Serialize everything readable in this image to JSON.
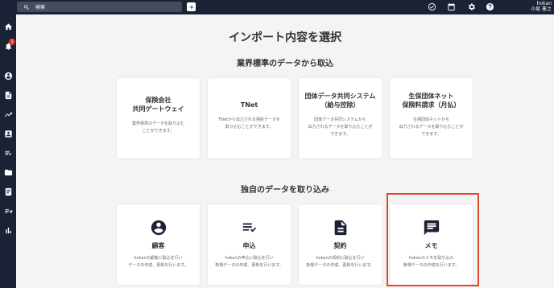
{
  "topbar": {
    "search_placeholder": "検索",
    "user_company": "hokan",
    "user_name": "小坂 憲之"
  },
  "sidebar": {
    "notification_count": "1",
    "icons": [
      "home-icon",
      "bell-icon",
      "account-icon",
      "document-icon",
      "trend-icon",
      "contact-icon",
      "list-check-icon",
      "folder-icon",
      "book-icon",
      "compare-icon",
      "bar-chart-icon"
    ]
  },
  "main": {
    "title": "インポート内容を選択",
    "standard_section": {
      "heading": "業界標準のデータから取込",
      "cards": [
        {
          "title": "保険会社\n共同ゲートウェイ",
          "desc": "業界標準のデータを取り込む\nことができます。"
        },
        {
          "title": "TNet",
          "desc": "TNetから出力される契約データを\n取り込むことができます。"
        },
        {
          "title": "団体データ共同システム\n（給与控除）",
          "desc": "団体データ共同システムから\n出力されるデータを取り込むことが\nできます。"
        },
        {
          "title": "生保団体ネット\n保険料請求（月払）",
          "desc": "生保団体ネットから\n出力されるデータを取り込むことが\nできます。"
        }
      ]
    },
    "custom_section": {
      "heading": "独自のデータを取り込み",
      "cards": [
        {
          "title": "顧客",
          "icon": "person-circle-icon",
          "desc": "hokanの顧客に取込を行い\nデータの作成、更新を行います。"
        },
        {
          "title": "申込",
          "icon": "list-check-icon",
          "desc": "hokanの申込に取込を行い\n新規データの作成、更新を行います。"
        },
        {
          "title": "契約",
          "icon": "document-icon",
          "desc": "hokanの契約に取込を行い\n新規データの作成、更新を行います。"
        },
        {
          "title": "メモ",
          "icon": "memo-icon",
          "desc": "hokanのメモを取り込み\n新規データの作成を行います。"
        }
      ]
    }
  },
  "colors": {
    "nav_background": "#1c2235",
    "highlight_border": "#e0482b"
  }
}
